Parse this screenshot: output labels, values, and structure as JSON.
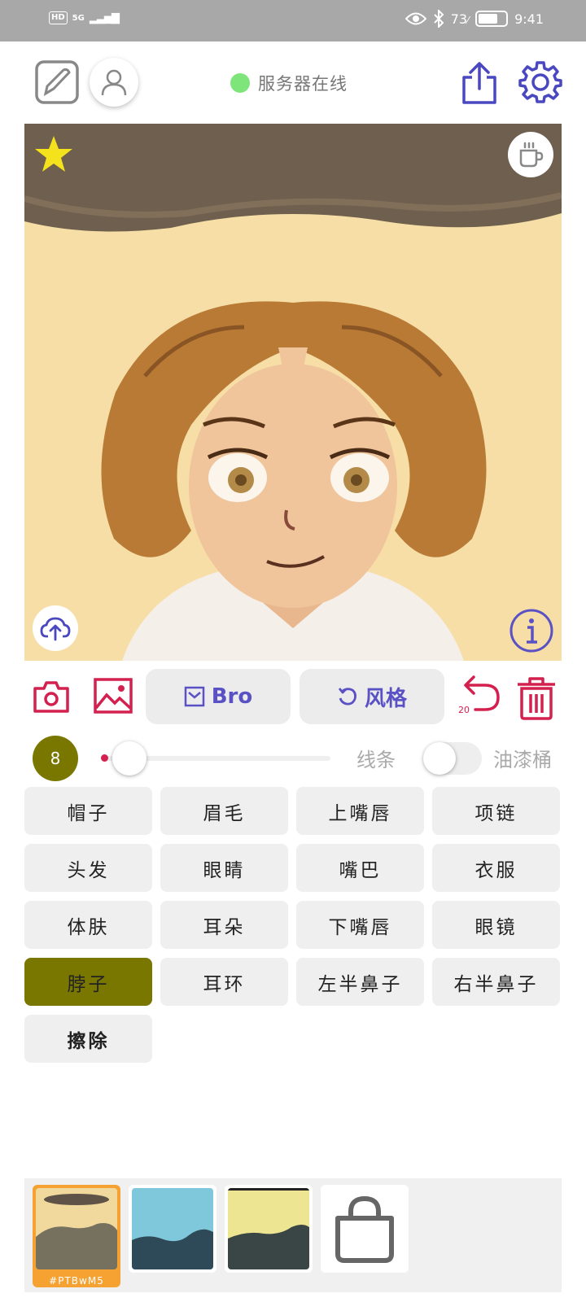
{
  "status_bar": {
    "hd": "HD",
    "network": "5G",
    "battery_text": "73",
    "battery_level": 0.73,
    "time": "9:41",
    "icons": [
      "eye-icon",
      "bluetooth-icon",
      "battery-icon"
    ]
  },
  "toolbar": {
    "server_status": "服务器在线",
    "server_color": "#7ee57a",
    "icons": [
      "edit-icon",
      "user-icon",
      "share-icon",
      "gear-icon"
    ]
  },
  "canvas": {
    "icons": [
      "star-icon",
      "coffee-icon",
      "cloud-upload-icon",
      "info-icon"
    ]
  },
  "controls": {
    "bro_label": "Bro",
    "style_label": "风格",
    "undo_count": "20",
    "accent": "#d4204f",
    "purple": "#5a52c4"
  },
  "brush": {
    "size": "8",
    "slider_value": 0.05,
    "line_label": "线条",
    "bucket_label": "油漆桶",
    "bucket_enabled": false
  },
  "parts": {
    "items": [
      {
        "label": "帽子"
      },
      {
        "label": "眉毛"
      },
      {
        "label": "上嘴唇"
      },
      {
        "label": "项链"
      },
      {
        "label": "头发"
      },
      {
        "label": "眼睛"
      },
      {
        "label": "嘴巴"
      },
      {
        "label": "衣服"
      },
      {
        "label": "体肤"
      },
      {
        "label": "耳朵"
      },
      {
        "label": "下嘴唇"
      },
      {
        "label": "眼镜"
      },
      {
        "label": "脖子"
      },
      {
        "label": "耳环"
      },
      {
        "label": "左半鼻子"
      },
      {
        "label": "右半鼻子"
      },
      {
        "label": "擦除"
      }
    ],
    "selected": "脖子",
    "selected_color": "#7a7700"
  },
  "gallery": {
    "selected_tag": "#PTBwM5",
    "selected_color": "#f5a233",
    "icons": [
      "bag-icon"
    ]
  }
}
